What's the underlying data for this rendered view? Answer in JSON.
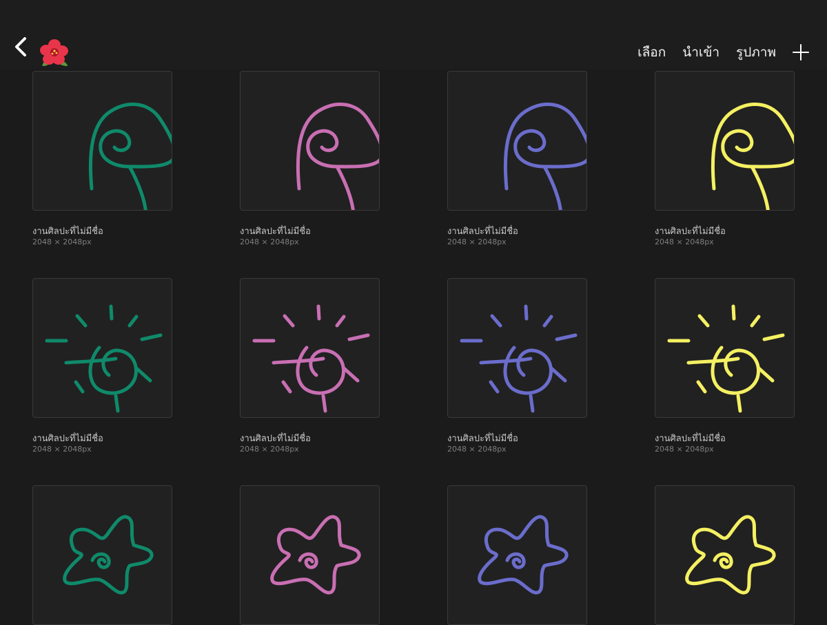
{
  "header": {
    "back_icon": "chevron-left-icon",
    "flower_icon": "hibiscus-icon",
    "actions": [
      "เลือก",
      "นำเข้า",
      "รูปภาพ"
    ],
    "add_icon": "plus-icon"
  },
  "colors": {
    "green": "#0f8a6a",
    "pink": "#c96fb3",
    "blue": "#6b6dcc",
    "yellow": "#f4f062"
  },
  "gallery": {
    "items": [
      {
        "shape": "mushroom-icon",
        "color": "#0f8a6a",
        "title": "งานศิลปะที่ไม่มีชื่อ",
        "size": "2048 × 2048px"
      },
      {
        "shape": "mushroom-icon",
        "color": "#c96fb3",
        "title": "งานศิลปะที่ไม่มีชื่อ",
        "size": "2048 × 2048px"
      },
      {
        "shape": "mushroom-icon",
        "color": "#6b6dcc",
        "title": "งานศิลปะที่ไม่มีชื่อ",
        "size": "2048 × 2048px"
      },
      {
        "shape": "mushroom-icon",
        "color": "#f4f062",
        "title": "งานศิลปะที่ไม่มีชื่อ",
        "size": "2048 × 2048px"
      },
      {
        "shape": "sun-icon",
        "color": "#0f8a6a",
        "title": "งานศิลปะที่ไม่มีชื่อ",
        "size": "2048 × 2048px"
      },
      {
        "shape": "sun-icon",
        "color": "#c96fb3",
        "title": "งานศิลปะที่ไม่มีชื่อ",
        "size": "2048 × 2048px"
      },
      {
        "shape": "sun-icon",
        "color": "#6b6dcc",
        "title": "งานศิลปะที่ไม่มีชื่อ",
        "size": "2048 × 2048px"
      },
      {
        "shape": "sun-icon",
        "color": "#f4f062",
        "title": "งานศิลปะที่ไม่มีชื่อ",
        "size": "2048 × 2048px"
      },
      {
        "shape": "starfish-icon",
        "color": "#0f8a6a",
        "title": "",
        "size": ""
      },
      {
        "shape": "starfish-icon",
        "color": "#c96fb3",
        "title": "",
        "size": ""
      },
      {
        "shape": "starfish-icon",
        "color": "#6b6dcc",
        "title": "",
        "size": ""
      },
      {
        "shape": "starfish-icon",
        "color": "#f4f062",
        "title": "",
        "size": ""
      }
    ]
  }
}
